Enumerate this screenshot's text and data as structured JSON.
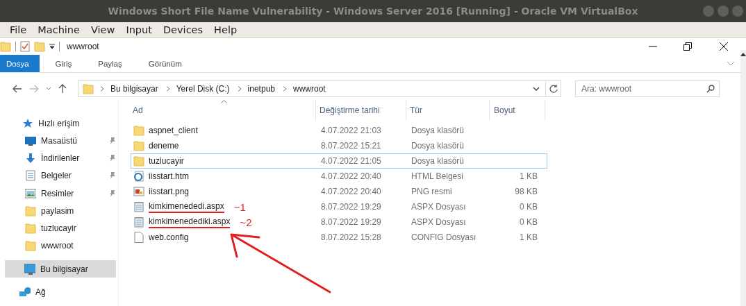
{
  "window": {
    "title": "Windows Short File Name Vulnerability - Windows Server 2016 [Running] - Oracle VM VirtualBox"
  },
  "menu": [
    "File",
    "Machine",
    "View",
    "Input",
    "Devices",
    "Help"
  ],
  "explorer": {
    "title": "wwwroot",
    "tabs": [
      {
        "label": "Dosya",
        "selected": true
      },
      {
        "label": "Giriş",
        "selected": false
      },
      {
        "label": "Paylaş",
        "selected": false
      },
      {
        "label": "Görünüm",
        "selected": false
      }
    ],
    "breadcrumb": [
      "Bu bilgisayar",
      "Yerel Disk (C:)",
      "inetpub",
      "wwwroot"
    ],
    "search": {
      "placeholder": "Ara: wwwroot"
    },
    "sidebar": [
      {
        "label": "Hızlı erişim",
        "kind": "star",
        "pinned": false,
        "selected": false
      },
      {
        "label": "Masaüstü",
        "kind": "desktop",
        "pinned": true,
        "selected": false
      },
      {
        "label": "İndirilenler",
        "kind": "download",
        "pinned": true,
        "selected": false
      },
      {
        "label": "Belgeler",
        "kind": "document",
        "pinned": true,
        "selected": false
      },
      {
        "label": "Resimler",
        "kind": "image",
        "pinned": true,
        "selected": false
      },
      {
        "label": "paylasim",
        "kind": "folder",
        "pinned": false,
        "selected": false
      },
      {
        "label": "tuzlucayir",
        "kind": "folder",
        "pinned": false,
        "selected": false
      },
      {
        "label": "wwwroot",
        "kind": "folder",
        "pinned": false,
        "selected": false
      },
      {
        "label": "Bu bilgisayar",
        "kind": "computer",
        "pinned": false,
        "selected": true
      },
      {
        "label": "Ağ",
        "kind": "network",
        "pinned": false,
        "selected": false
      }
    ],
    "columns": [
      "Ad",
      "Değiştirme tarihi",
      "Tür",
      "Boyut"
    ],
    "rows": [
      {
        "name": "aspnet_client",
        "date": "4.07.2022 21:03",
        "type": "Dosya klasörü",
        "kind": "folder",
        "selected": false
      },
      {
        "name": "deneme",
        "date": "8.07.2022 15:21",
        "type": "Dosya klasörü",
        "kind": "folder",
        "selected": false
      },
      {
        "name": "tuzlucayir",
        "date": "4.07.2022 21:05",
        "type": "Dosya klasörü",
        "kind": "folder",
        "selected": true
      },
      {
        "name": "iisstart.htm",
        "date": "4.07.2022 20:40",
        "type": "HTML Belgesi",
        "size": "1 KB",
        "kind": "html",
        "selected": false
      },
      {
        "name": "iisstart.png",
        "date": "4.07.2022 20:40",
        "type": "PNG resmi",
        "size": "98 KB",
        "kind": "png",
        "selected": false
      },
      {
        "name": "kimkimenededi.aspx",
        "date": "8.07.2022 19:29",
        "type": "ASPX Dosyası",
        "size": "0 KB",
        "kind": "aspx",
        "selected": false,
        "note": "~1"
      },
      {
        "name": "kimkimenedediki.aspx",
        "date": "8.07.2022 19:29",
        "type": "ASPX Dosyası",
        "size": "0 KB",
        "kind": "aspx",
        "selected": false,
        "note": "~2"
      },
      {
        "name": "web.config",
        "date": "8.07.2022 15:28",
        "type": "CONFIG Dosyası",
        "size": "1 KB",
        "kind": "file",
        "selected": false
      }
    ]
  }
}
